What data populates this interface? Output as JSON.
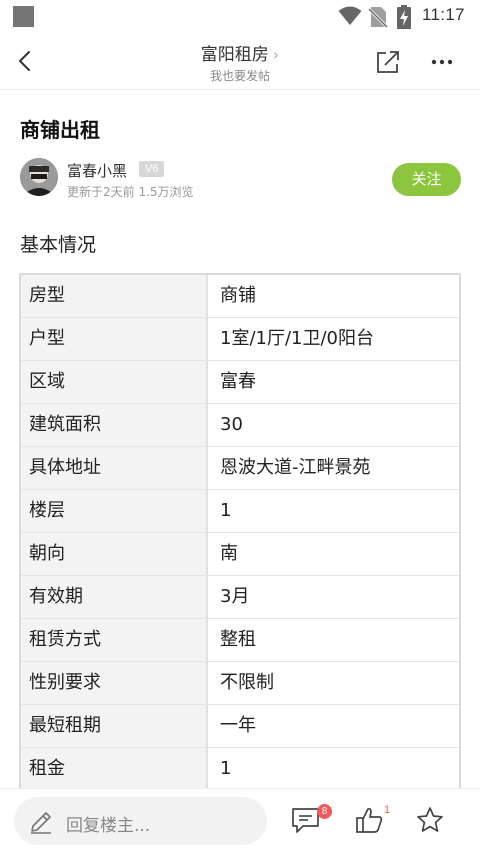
{
  "status_bar": {
    "time": "11:17"
  },
  "nav": {
    "title": "富阳租房",
    "title_chevron": "›",
    "subtitle": "我也要发帖",
    "icons": [
      "back-arrow-icon",
      "share-icon",
      "more-icon"
    ]
  },
  "post": {
    "title": "商铺出租",
    "author": {
      "name": "富春小黑",
      "level": "V6",
      "meta": "更新于2天前  1.5万浏览"
    },
    "follow_label": "关注"
  },
  "section": {
    "title": "基本情况"
  },
  "info_rows": [
    {
      "key": "房型",
      "value": "商铺"
    },
    {
      "key": "户型",
      "value": "1室/1厅/1卫/0阳台"
    },
    {
      "key": "区域",
      "value": "富春"
    },
    {
      "key": "建筑面积",
      "value": "30"
    },
    {
      "key": "具体地址",
      "value": "恩波大道-江畔景苑"
    },
    {
      "key": "楼层",
      "value": "1"
    },
    {
      "key": "朝向",
      "value": "南"
    },
    {
      "key": "有效期",
      "value": "3月"
    },
    {
      "key": "租赁方式",
      "value": "整租"
    },
    {
      "key": "性别要求",
      "value": "不限制"
    },
    {
      "key": "最短租期",
      "value": "一年"
    },
    {
      "key": "租金",
      "value": "1"
    }
  ],
  "bottom_bar": {
    "reply_placeholder": "回复楼主...",
    "comment_count": "8",
    "like_count": "1"
  },
  "colors": {
    "follow_button": "#8cc63f",
    "badge": "#f25a5a",
    "table_key_bg": "#f3f3f3",
    "table_border": "#d9d9d9"
  }
}
